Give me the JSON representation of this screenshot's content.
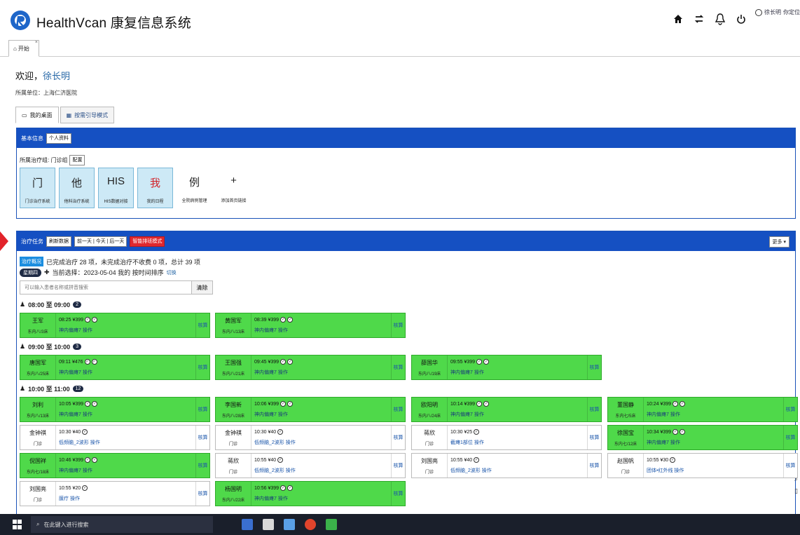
{
  "header": {
    "app_title": "HealthVcan 康复信息系统",
    "icons": [
      "home-icon",
      "swap-icon",
      "bell-icon",
      "power-icon"
    ],
    "user_name": "徐长明",
    "user_extra": "你定位"
  },
  "tabs": {
    "start_label": "开始"
  },
  "welcome": {
    "prefix": "欢迎，",
    "name": "徐长明",
    "unit": "所属单位：上海仁济医院"
  },
  "view_tabs": [
    "我的桌面",
    "按需引导模式"
  ],
  "basic_panel": {
    "title": "基本信息",
    "personal_btn": "个人资料",
    "shortcut_label": "所属治疗组: 门诊组",
    "settings_btn": "配置",
    "shortcuts": [
      {
        "char": "门",
        "label": "门诊治疗系统",
        "boxed": true
      },
      {
        "char": "他",
        "label": "他科治疗系统",
        "boxed": true
      },
      {
        "char": "HIS",
        "label": "HIS数据对接",
        "boxed": true
      },
      {
        "char": "我",
        "label": "我的日程",
        "boxed": true
      },
      {
        "char": "例",
        "label": "全院病例管理",
        "boxed": false
      },
      {
        "char": "+",
        "label": "添加首页链接",
        "boxed": false
      }
    ]
  },
  "task_panel": {
    "title": "治疗任务",
    "btn_refresh": "刷新数据",
    "btn_days": "前一天 | 今天 | 后一天",
    "btn_mode": "智能排班模式",
    "btn_more": "更多",
    "stats_badge": "治疗概况",
    "stats_text": "已完成治疗 28 项，未完成治疗不收费 0 项，总计 39 项",
    "week_badge": "星期四",
    "date_text": "当前选择：2023-05-04 我的 按时间排序",
    "date_link": "切换",
    "search_placeholder": "可以输入患者名称或拼音搜索",
    "search_btn": "清除",
    "slots": [
      {
        "label": "08:00 至 09:00",
        "count": "2"
      },
      {
        "label": "09:00 至 10:00",
        "count": "3"
      },
      {
        "label": "10:00 至 11:00",
        "count": "12"
      }
    ],
    "cards": [
      {
        "name": "王军",
        "bed": "东内八/3床",
        "time": "08:25 ¥399",
        "item": "神内偏瘫7 操作",
        "green": true
      },
      {
        "name": "黄国军",
        "bed": "东内八/13床",
        "time": "08:39 ¥399",
        "item": "神内偏瘫7 操作",
        "green": true
      },
      {
        "name": "唐国军",
        "bed": "东内八/25床",
        "time": "09:11 ¥476",
        "item": "神内偏瘫7 操作",
        "green": true
      },
      {
        "name": "王国强",
        "bed": "东内八/21床",
        "time": "09:45 ¥399",
        "item": "神内偏瘫7 操作",
        "green": true
      },
      {
        "name": "薛国华",
        "bed": "东内八/19床",
        "time": "09:55 ¥399",
        "item": "神内偏瘫7 操作",
        "green": true
      },
      {
        "name": "刘利",
        "bed": "东内八/13床",
        "time": "10:05 ¥399",
        "item": "神内偏瘫7 操作",
        "green": true
      },
      {
        "name": "李国新",
        "bed": "东内八/28床",
        "time": "10:06 ¥399",
        "item": "神内偏瘫7 操作",
        "green": true
      },
      {
        "name": "欧阳明",
        "bed": "东内八/24床",
        "time": "10:14 ¥399",
        "item": "神内偏瘫7 操作",
        "green": true
      },
      {
        "name": "董国静",
        "bed": "东内七/5床",
        "time": "10:24 ¥399",
        "item": "神内偏瘫7 操作",
        "green": true
      },
      {
        "name": "金钟祺",
        "bed": "门诊",
        "time": "10:30 ¥40",
        "item": "低频脑_2波形 操作",
        "green": false
      },
      {
        "name": "金钟祺",
        "bed": "门诊",
        "time": "10:30 ¥40",
        "item": "低频脑_2波形 操作",
        "green": false
      },
      {
        "name": "蒋欣",
        "bed": "门诊",
        "time": "10:30 ¥25",
        "item": "截瘫1部位 操作",
        "green": false
      },
      {
        "name": "徐国宝",
        "bed": "东内七/12床",
        "time": "10:34 ¥399",
        "item": "神内偏瘫7 操作",
        "green": true
      },
      {
        "name": "倪国祥",
        "bed": "东内七/18床",
        "time": "10:46 ¥399",
        "item": "神内偏瘫7 操作",
        "green": true
      },
      {
        "name": "蒋欣",
        "bed": "门诊",
        "time": "10:55 ¥40",
        "item": "低频脑_2波形 操作",
        "green": false
      },
      {
        "name": "刘国亮",
        "bed": "门诊",
        "time": "10:55 ¥40",
        "item": "低频脑_2波形 操作",
        "green": false
      },
      {
        "name": "赵国帆",
        "bed": "门诊",
        "time": "10:55 ¥30",
        "item": "团体•红外线 操作",
        "green": false
      },
      {
        "name": "刘国亮",
        "bed": "门诊",
        "time": "10:55 ¥20",
        "item": "膜疗 操作",
        "green": false
      },
      {
        "name": "杨国明",
        "bed": "东内八/22床",
        "time": "10:56 ¥399",
        "item": "神内偏瘫7 操作",
        "green": true
      }
    ],
    "card_action": "核算"
  },
  "taskbar": {
    "search_placeholder": "在此键入进行搜索"
  }
}
